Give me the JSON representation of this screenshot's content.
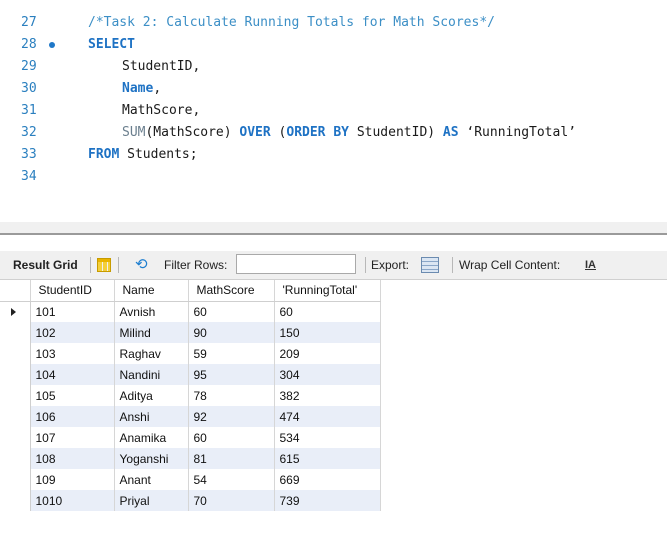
{
  "editor": {
    "lines": [
      {
        "num": "27",
        "indent": 0,
        "tokens": [
          {
            "t": "cmt",
            "v": "/*Task 2: Calculate Running Totals for Math Scores*/"
          }
        ]
      },
      {
        "num": "28",
        "indent": 0,
        "breakpoint": true,
        "tokens": [
          {
            "t": "kw",
            "v": "SELECT"
          }
        ]
      },
      {
        "num": "29",
        "indent": 1,
        "tokens": [
          {
            "t": "plain",
            "v": "StudentID,"
          }
        ]
      },
      {
        "num": "30",
        "indent": 1,
        "tokens": [
          {
            "t": "kw",
            "v": "Name"
          },
          {
            "t": "plain",
            "v": ","
          }
        ]
      },
      {
        "num": "31",
        "indent": 1,
        "tokens": [
          {
            "t": "plain",
            "v": "MathScore,"
          }
        ]
      },
      {
        "num": "32",
        "indent": 1,
        "tokens": [
          {
            "t": "fn",
            "v": "SUM"
          },
          {
            "t": "plain",
            "v": "(MathScore) "
          },
          {
            "t": "kw",
            "v": "OVER"
          },
          {
            "t": "plain",
            "v": " ("
          },
          {
            "t": "kw",
            "v": "ORDER BY"
          },
          {
            "t": "plain",
            "v": " StudentID) "
          },
          {
            "t": "kw",
            "v": "AS"
          },
          {
            "t": "str",
            "v": " ‘RunningTotal’"
          }
        ]
      },
      {
        "num": "33",
        "indent": 0,
        "tokens": [
          {
            "t": "kw",
            "v": "FROM"
          },
          {
            "t": "plain",
            "v": " Students;"
          }
        ]
      },
      {
        "num": "34",
        "indent": 0,
        "tokens": []
      }
    ]
  },
  "toolbar": {
    "result_grid_label": "Result Grid",
    "grid_icon": "grid-icon",
    "refresh_icon": "refresh-icon",
    "filter_label": "Filter Rows:",
    "filter_value": "",
    "export_label": "Export:",
    "export_icon": "export-icon",
    "wrap_label": "Wrap Cell Content:",
    "wrap_icon_glyph": "IA"
  },
  "grid": {
    "columns": [
      "StudentID",
      "Name",
      "MathScore",
      "'RunningTotal'"
    ],
    "rows": [
      [
        "101",
        "Avnish",
        "60",
        "60"
      ],
      [
        "102",
        "Milind",
        "90",
        "150"
      ],
      [
        "103",
        "Raghav",
        "59",
        "209"
      ],
      [
        "104",
        "Nandini",
        "95",
        "304"
      ],
      [
        "105",
        "Aditya",
        "78",
        "382"
      ],
      [
        "106",
        "Anshi",
        "92",
        "474"
      ],
      [
        "107",
        "Anamika",
        "60",
        "534"
      ],
      [
        "108",
        "Yoganshi",
        "81",
        "615"
      ],
      [
        "109",
        "Anant",
        "54",
        "669"
      ],
      [
        "1010",
        "Priyal",
        "70",
        "739"
      ]
    ],
    "current_row": 0
  }
}
